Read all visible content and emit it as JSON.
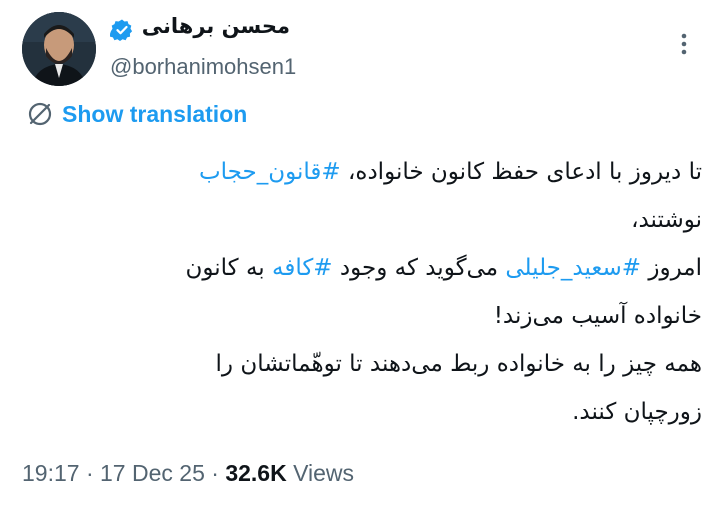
{
  "author": {
    "name": "محسن برهانی",
    "handle": "@borhanimohsen1",
    "verified_color": "#1d9bf0"
  },
  "translate": {
    "label": "Show translation",
    "icon": "translate-icon"
  },
  "tweet": {
    "line1_text": "تا دیروز با ادعای حفظ کانون خانواده، ",
    "line1_hashtag": "#قانون_حجاب",
    "line2_text": "نوشتند،",
    "line3_part1": "امروز ",
    "line3_hashtag1": "#سعید_جلیلی",
    "line3_part2": " می‌گوید که وجود ",
    "line3_hashtag2": "#کافه",
    "line3_part3": " به کانون",
    "line4_text": "خانواده آسیب می‌زند!",
    "line5_text": "همه چیز را به خانواده ربط می‌دهند تا توهّماتشان را",
    "line6_text": "زورچپان کنند."
  },
  "meta": {
    "time": "19:17",
    "sep1": " · ",
    "date": "17 Dec 25",
    "sep2": " · ",
    "views_count": "32.6K",
    "views_label": " Views"
  },
  "colors": {
    "accent": "#1d9bf0",
    "text": "#0f1419",
    "secondary": "#536471"
  }
}
